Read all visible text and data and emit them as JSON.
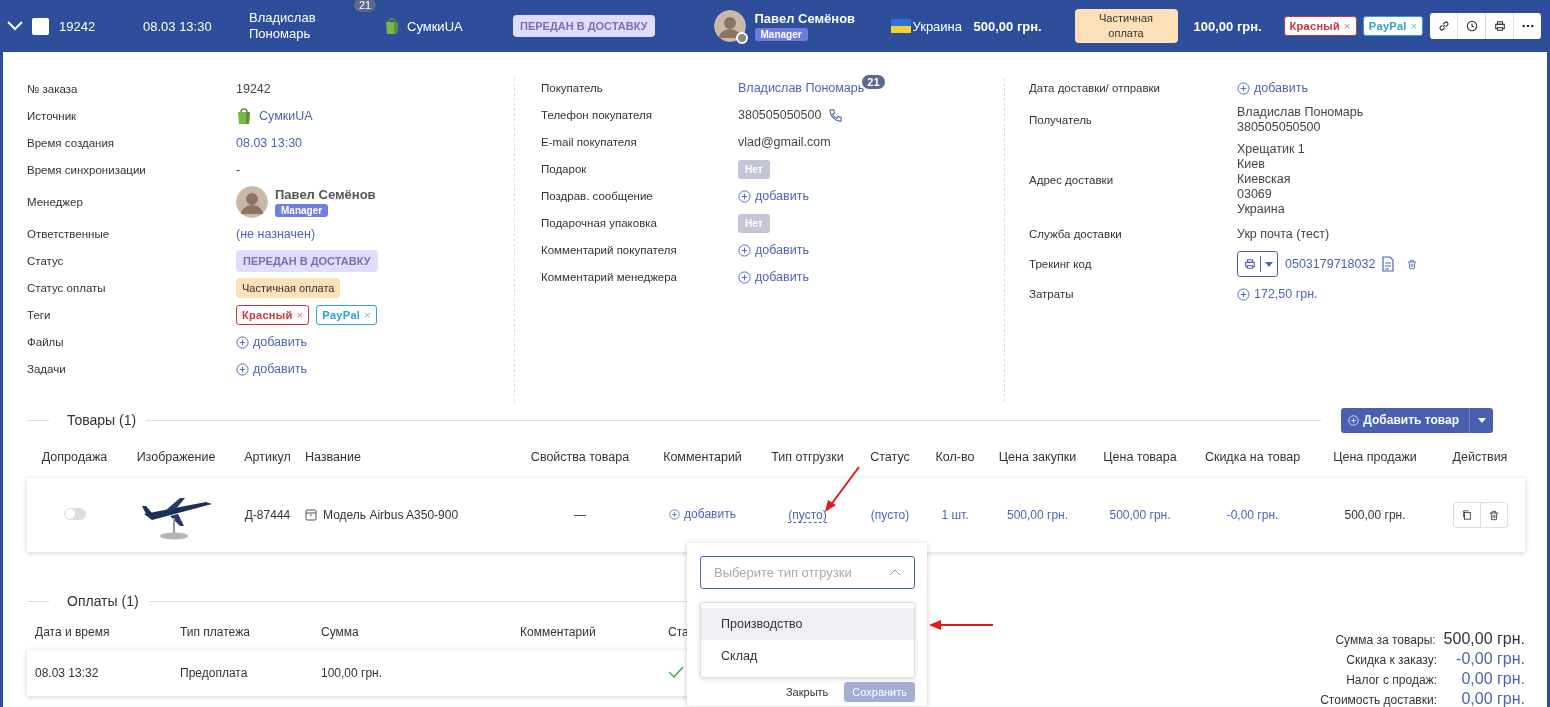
{
  "header": {
    "expanded": true,
    "checked": false,
    "order_id": "19242",
    "date": "08.03 13:30",
    "customer": "Владислав Пономарь",
    "customer_count": "21",
    "source": "СумкиUA",
    "status": "ПЕРЕДАН В ДОСТАВКУ",
    "manager": {
      "name": "Павел Семёнов",
      "role": "Manager",
      "online": false
    },
    "country": "Украина",
    "total": "500,00 грн.",
    "payment_status": "Частичная оплата",
    "paid": "100,00 грн.",
    "tags": [
      {
        "label": "Красный",
        "close": "×",
        "color": "#d0343c"
      },
      {
        "label": "PayPal",
        "close": "×",
        "color": "#2a9fd8"
      }
    ]
  },
  "details": [
    {
      "rows": [
        {
          "label": "№ заказа",
          "kind": "text",
          "value": "19242"
        },
        {
          "label": "Источник",
          "kind": "source",
          "value": "СумкиUA"
        },
        {
          "label": "Время создания",
          "kind": "link",
          "value": "08.03 13:30"
        },
        {
          "label": "Время синхронизации",
          "kind": "text",
          "value": "-"
        },
        {
          "label": "Менеджер",
          "kind": "manager",
          "name": "Павел Семёнов",
          "role": "Manager"
        },
        {
          "label": "Ответственные",
          "kind": "link",
          "value": "(не назначен)"
        },
        {
          "label": "Статус",
          "kind": "status",
          "value": "ПЕРЕДАН В ДОСТАВКУ"
        },
        {
          "label": "Статус оплаты",
          "kind": "payment",
          "value": "Частичная оплата"
        },
        {
          "label": "Теги",
          "kind": "tags",
          "tags": [
            {
              "label": "Красный",
              "close": "×",
              "color": "#d0343c"
            },
            {
              "label": "PayPal",
              "close": "×",
              "color": "#2a9fd8"
            }
          ]
        },
        {
          "label": "Файлы",
          "kind": "add",
          "value": "добавить"
        },
        {
          "label": "Задачи",
          "kind": "add",
          "value": "добавить"
        }
      ]
    },
    {
      "rows": [
        {
          "label": "Покупатель",
          "kind": "badge_link",
          "value": "Владислав Пономарь",
          "count": "21"
        },
        {
          "label": "Телефон покупателя",
          "kind": "phone",
          "value": "380505050500"
        },
        {
          "label": "E-mail покупателя",
          "kind": "text",
          "value": "vlad@gmail.com"
        },
        {
          "label": "Подарок",
          "kind": "pill",
          "value": "Нет"
        },
        {
          "label": "Поздрав. сообщение",
          "kind": "add",
          "value": "добавить"
        },
        {
          "label": "Подарочная упаковка",
          "kind": "pill",
          "value": "Нет"
        },
        {
          "label": "Комментарий покупателя",
          "kind": "add",
          "value": "добавить"
        },
        {
          "label": "Комментарий менеджера",
          "kind": "add",
          "value": "добавить"
        }
      ]
    },
    {
      "rows": [
        {
          "label": "Дата доставки/ отправки",
          "kind": "add",
          "value": "добавить"
        },
        {
          "label": "Получатель",
          "kind": "lines",
          "lines": [
            "Владислав Пономарь",
            "380505050500"
          ]
        },
        {
          "label": "Адрес доставки",
          "kind": "lines",
          "lines": [
            "Хрещатик 1",
            "Киев",
            "Киевская",
            "03069",
            "Украина"
          ]
        },
        {
          "label": "Служба доставки",
          "kind": "text",
          "value": "Укр почта (тест)"
        },
        {
          "label": "Трекинг код",
          "kind": "tracking",
          "value": "0503179718032"
        },
        {
          "label": "Затраты",
          "kind": "cost",
          "value": "172,50 грн."
        }
      ]
    }
  ],
  "products": {
    "title": "Товары (1)",
    "add_button": "Добавить товар",
    "columns": [
      "Допродажа",
      "Изображение",
      "Артикул",
      "Название",
      "Свойства товара",
      "Комментарий",
      "Тип отгрузки",
      "Статус",
      "Кол-во",
      "Цена закупки",
      "Цена товара",
      "Скидка на товар",
      "Цена продажи",
      "Действия"
    ],
    "rows": [
      {
        "upsell": false,
        "article": "Д-87444",
        "name": "Модель Airbus A350-900",
        "properties": "—",
        "comment": "добавить",
        "shipment": "(пусто)",
        "status": "(пусто)",
        "qty": "1 шт.",
        "purchase": "500,00 грн.",
        "price": "500,00 грн.",
        "discount": "-0,00 грн.",
        "sale": "500,00 грн."
      }
    ]
  },
  "payments": {
    "title": "Оплаты (1)",
    "columns": [
      "Дата и время",
      "Тип платежа",
      "Сумма",
      "Комментарий",
      "Ста"
    ],
    "rows": [
      {
        "date": "08.03 13:32",
        "type": "Предоплата",
        "sum": "100,00 грн.",
        "paid": true
      }
    ]
  },
  "totals": [
    {
      "label": "Сумма за товары:",
      "value": "500,00 грн.",
      "kind": "plain"
    },
    {
      "label": "Скидка к заказу:",
      "value": "-0,00 грн.",
      "kind": "link"
    },
    {
      "label": "Налог с продаж:",
      "value": "0,00 грн.",
      "kind": "link"
    },
    {
      "label": "Стоимость доставки:",
      "value": "0,00 грн.",
      "kind": "link"
    }
  ],
  "shipment_popup": {
    "placeholder": "Выберите тип отгрузки",
    "options": [
      {
        "label": "Производство",
        "selected": true
      },
      {
        "label": "Склад",
        "selected": false
      }
    ],
    "buttons": [
      {
        "label": "Закрыть",
        "disabled": false
      },
      {
        "label": "Сохранить",
        "disabled": true
      }
    ]
  }
}
